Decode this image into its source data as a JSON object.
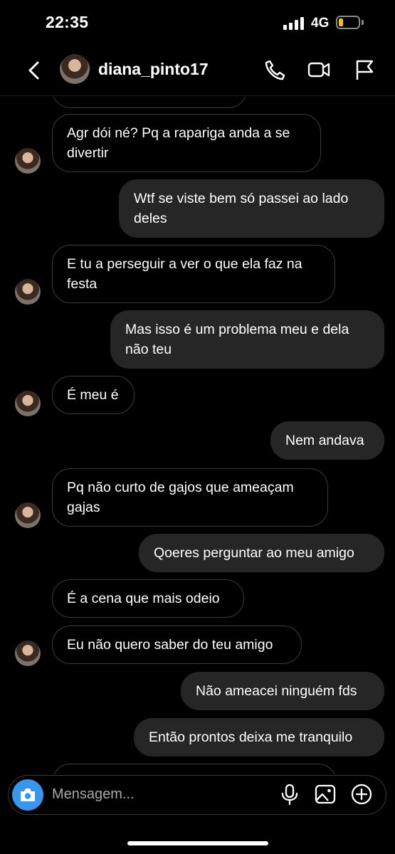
{
  "status": {
    "time": "22:35",
    "network": "4G"
  },
  "header": {
    "username": "diana_pinto17"
  },
  "messages": [
    {
      "text": "Agr dói né? Pq a rapariga anda a se divertir"
    },
    {
      "text": "Wtf se viste bem só passei ao lado deles"
    },
    {
      "text": "E tu a perseguir a ver o que ela faz na festa"
    },
    {
      "text": "Mas isso é um problema meu e dela não teu"
    },
    {
      "text": "É meu é"
    },
    {
      "text": "Nem andava"
    },
    {
      "text": "Pq não curto de gajos que ameaçam gajas"
    },
    {
      "text": "Qoeres perguntar ao meu amigo"
    },
    {
      "text": "É a cena que mais odeio"
    },
    {
      "text": "Eu não quero saber do teu amigo"
    },
    {
      "text": "Não ameacei ninguém fds"
    },
    {
      "text": "Então prontos deixa me tranquilo"
    }
  ],
  "composer": {
    "placeholder": "Mensagem..."
  },
  "icons": {
    "back": "chevron-left-icon",
    "call": "phone-icon",
    "video": "video-camera-icon",
    "report": "flag-icon",
    "camera": "camera-icon",
    "mic": "microphone-icon",
    "gallery": "image-icon",
    "more": "plus-circle-icon"
  },
  "colors": {
    "background": "#000000",
    "outgoing_bubble": "#262626",
    "camera_button": "#3797f0"
  }
}
